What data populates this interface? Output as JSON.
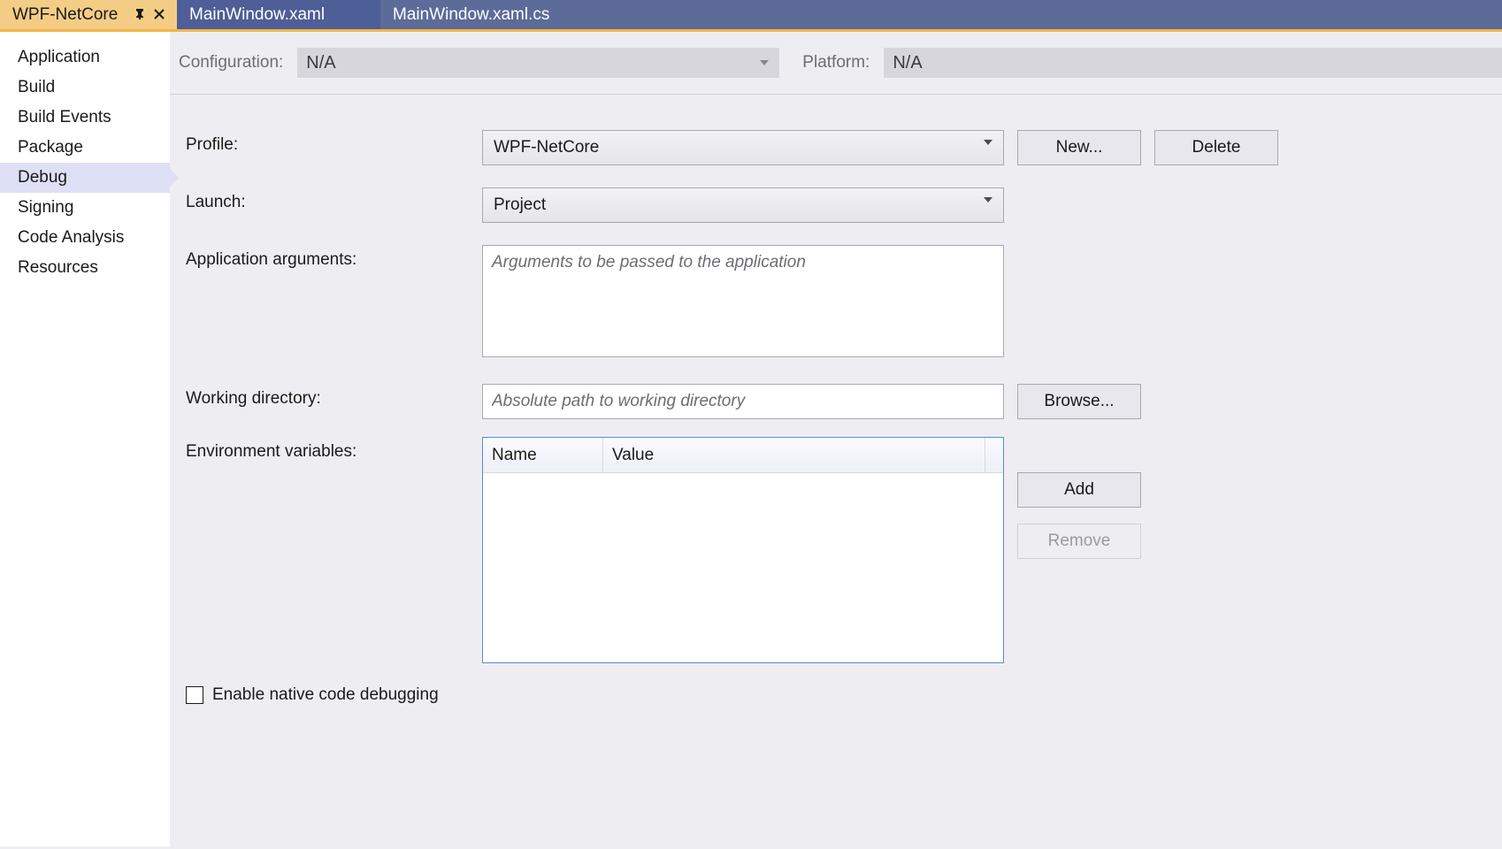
{
  "tabs": {
    "active": "WPF-NetCore",
    "items": [
      "WPF-NetCore",
      "MainWindow.xaml",
      "MainWindow.xaml.cs"
    ]
  },
  "sidebar": {
    "items": [
      "Application",
      "Build",
      "Build Events",
      "Package",
      "Debug",
      "Signing",
      "Code Analysis",
      "Resources"
    ],
    "selected": "Debug"
  },
  "configbar": {
    "configuration_label": "Configuration:",
    "configuration_value": "N/A",
    "platform_label": "Platform:",
    "platform_value": "N/A"
  },
  "form": {
    "profile_label": "Profile:",
    "profile_value": "WPF-NetCore",
    "new_button": "New...",
    "delete_button": "Delete",
    "launch_label": "Launch:",
    "launch_value": "Project",
    "args_label": "Application arguments:",
    "args_placeholder": "Arguments to be passed to the application",
    "args_value": "",
    "workdir_label": "Working directory:",
    "workdir_placeholder": "Absolute path to working directory",
    "workdir_value": "",
    "browse_button": "Browse...",
    "env_label": "Environment variables:",
    "env_columns": {
      "name": "Name",
      "value": "Value"
    },
    "add_button": "Add",
    "remove_button": "Remove",
    "native_debug_label": "Enable native code debugging",
    "native_debug_checked": false
  }
}
